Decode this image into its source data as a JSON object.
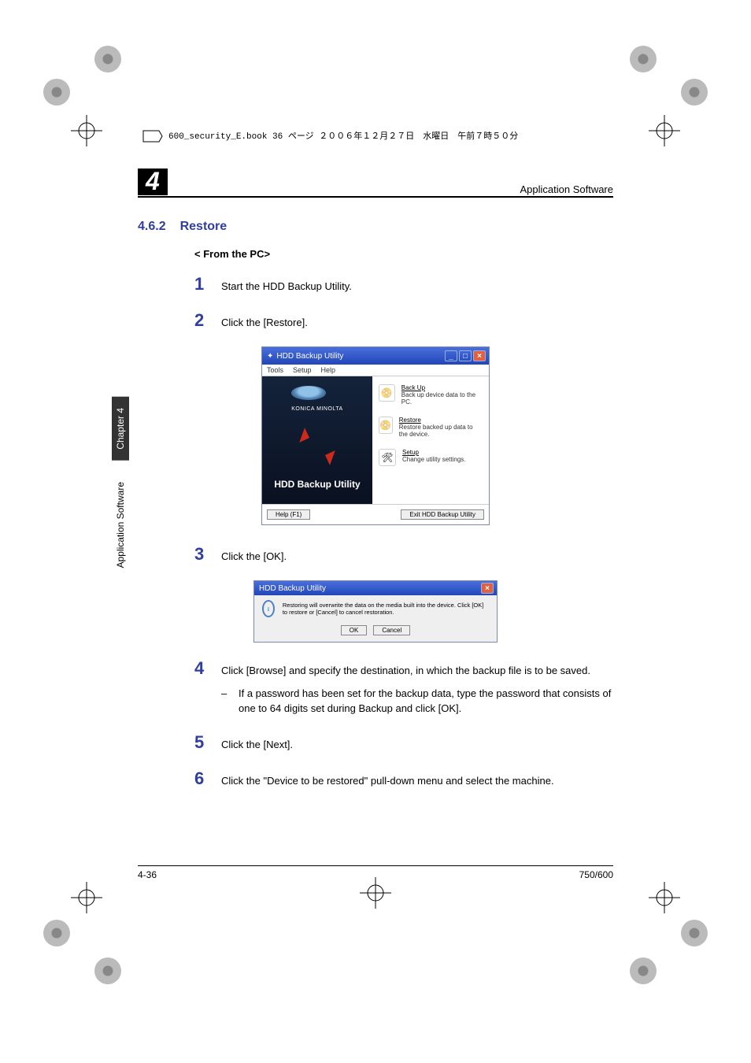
{
  "crop_header": "600_security_E.book  36 ページ    ２００６年１２月２７日　水曜日　午前７時５０分",
  "header": {
    "right_label": "Application Software",
    "chapter_number": "4"
  },
  "side_tabs": {
    "chapter_tab": "Chapter 4",
    "section_tab": "Application Software"
  },
  "section": {
    "number": "4.6.2",
    "title": "Restore"
  },
  "sub_heading": "< From the PC>",
  "steps": [
    {
      "n": "1",
      "text": "Start the HDD Backup Utility."
    },
    {
      "n": "2",
      "text": "Click the [Restore]."
    },
    {
      "n": "3",
      "text": "Click the [OK]."
    },
    {
      "n": "4",
      "text": "Click [Browse] and specify the destination, in which the backup file is to be saved.",
      "sub": "If a password has been set for the backup data, type the password that consists of one to 64 digits set during Backup and click [OK]."
    },
    {
      "n": "5",
      "text": "Click the [Next]."
    },
    {
      "n": "6",
      "text": "Click the \"Device to be restored\" pull-down menu and select the machine."
    }
  ],
  "screenshot1": {
    "title": "HDD Backup Utility",
    "menu": [
      "Tools",
      "Setup",
      "Help"
    ],
    "brand": "KONICA MINOLTA",
    "panel_title": "HDD Backup Utility",
    "options": [
      {
        "title": "Back Up",
        "desc": "Back up device data to the PC."
      },
      {
        "title": "Restore",
        "desc": "Restore backed up data to the device."
      },
      {
        "title": "Setup",
        "desc": "Change utility settings."
      }
    ],
    "footer_left": "Help (F1)",
    "footer_right": "Exit HDD Backup Utility",
    "app_icon": "✦"
  },
  "screenshot2": {
    "title": "HDD Backup Utility",
    "message": "Restoring will overwrite the data on the media built into the device. Click [OK] to restore or [Cancel] to cancel restoration.",
    "ok": "OK",
    "cancel": "Cancel"
  },
  "footer": {
    "left": "4-36",
    "right": "750/600"
  },
  "icons": {
    "minimize": "_",
    "maximize": "□",
    "close": "×",
    "backup": "📀",
    "restore": "📀",
    "setup": "🛠",
    "info": "i"
  }
}
